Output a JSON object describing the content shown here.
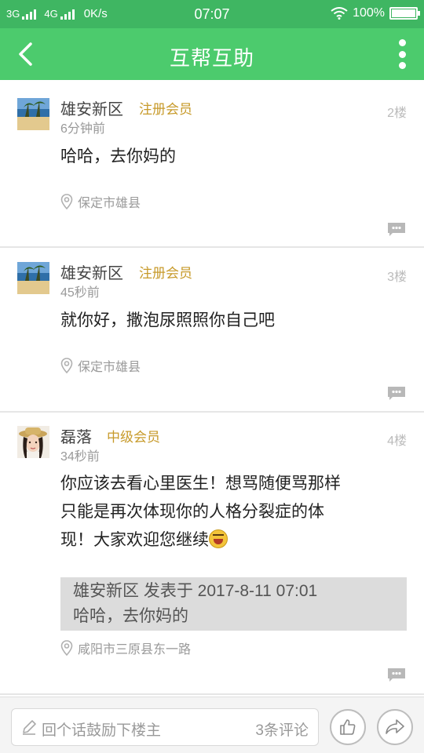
{
  "status_bar": {
    "network1": "3G",
    "network2": "4G",
    "speed": "0K/s",
    "time": "07:07",
    "battery": "100%",
    "battery_level": 1.0
  },
  "header": {
    "title": "互帮互助",
    "back_icon": "chevron-left-icon",
    "more_icon": "more-vertical-icon",
    "bg_color": "#4ccb6d"
  },
  "posts": [
    {
      "user": "雄安新区",
      "badge": "注册会员",
      "time": "6分钟前",
      "floor": "2楼",
      "content": "哈哈，去你妈的",
      "location": "保定市雄县"
    },
    {
      "user": "雄安新区",
      "badge": "注册会员",
      "time": "45秒前",
      "floor": "3楼",
      "content": "就你好，撒泡尿照照你自己吧",
      "location": "保定市雄县"
    },
    {
      "user": "磊落",
      "badge": "中级会员",
      "time": "34秒前",
      "floor": "4楼",
      "content_line1": "你应该去看心里医生！想骂随便骂那样",
      "content_line2": "只能是再次体现你的人格分裂症的体",
      "content_line3": "现！大家欢迎您继续",
      "quote_header": "雄安新区 发表于 2017-8-11 07:01",
      "quote_text": "哈哈，去你妈的",
      "location": "咸阳市三原县东一路"
    }
  ],
  "bottom_bar": {
    "placeholder": "回个话鼓励下楼主",
    "comment_count": "3条评论",
    "like_icon": "thumbs-up-icon",
    "share_icon": "share-icon"
  },
  "colors": {
    "badge": "#c79a2a",
    "status_bar": "#3fb662"
  }
}
